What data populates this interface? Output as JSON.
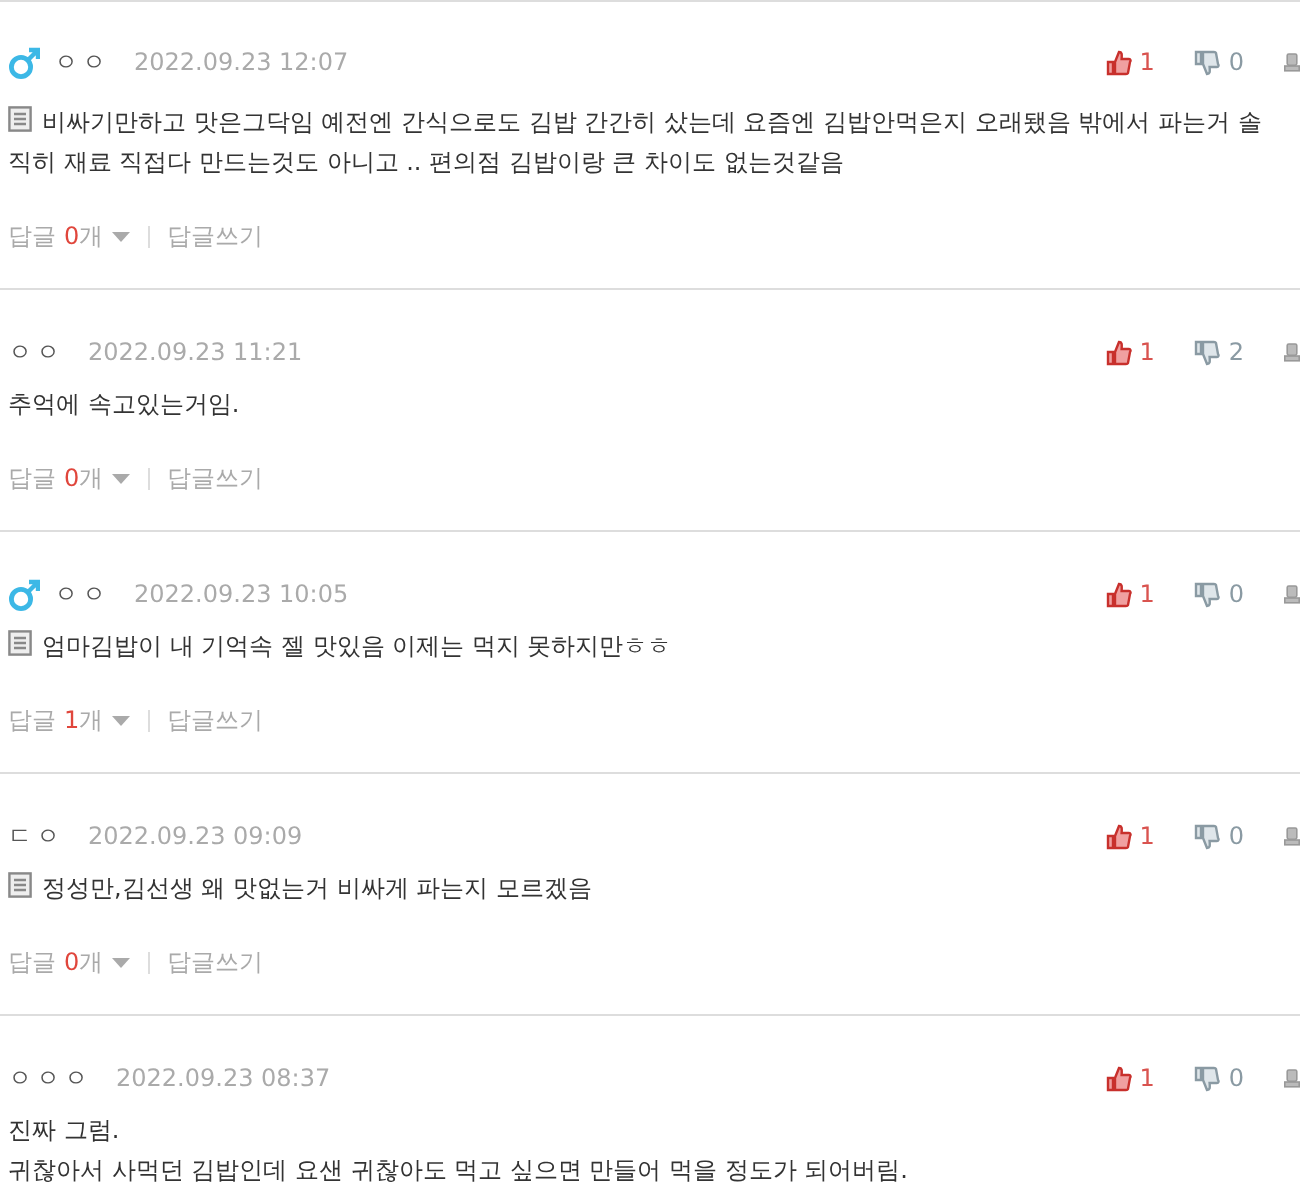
{
  "comments": [
    {
      "male": true,
      "nickname": "ㅇㅇ",
      "date": "2022.09.23 12:07",
      "likes": "1",
      "dislikes": "0",
      "memo": true,
      "body": [
        "비싸기만하고 맛은그닥임 예전엔 간식으로도 김밥 간간히 샀는데 요즘엔 김밥안먹은지 오래됐음 밖에서 파는거 솔직히 재료 직접다 만드는것도 아니고 .. 편의점 김밥이랑 큰 차이도 없는것같음"
      ],
      "reply": {
        "label": "답글",
        "count": "0",
        "unit": "개",
        "write": "답글쓰기"
      }
    },
    {
      "male": false,
      "nickname": "ㅇㅇ",
      "date": "2022.09.23 11:21",
      "likes": "1",
      "dislikes": "2",
      "memo": false,
      "body": [
        "추억에 속고있는거임."
      ],
      "reply": {
        "label": "답글",
        "count": "0",
        "unit": "개",
        "write": "답글쓰기"
      }
    },
    {
      "male": true,
      "nickname": "ㅇㅇ",
      "date": "2022.09.23 10:05",
      "likes": "1",
      "dislikes": "0",
      "memo": true,
      "body": [
        "엄마김밥이 내 기억속 젤 맛있음 이제는 먹지 못하지만ㅎㅎ"
      ],
      "reply": {
        "label": "답글",
        "count": "1",
        "unit": "개",
        "write": "답글쓰기"
      }
    },
    {
      "male": false,
      "nickname": "ㄷㅇ",
      "date": "2022.09.23 09:09",
      "likes": "1",
      "dislikes": "0",
      "memo": true,
      "body": [
        "정성만,김선생 왜 맛없는거 비싸게 파는지 모르겠음"
      ],
      "reply": {
        "label": "답글",
        "count": "0",
        "unit": "개",
        "write": "답글쓰기"
      }
    },
    {
      "male": false,
      "nickname": "ㅇㅇㅇ",
      "date": "2022.09.23 08:37",
      "likes": "1",
      "dislikes": "0",
      "memo": false,
      "body": [
        "진짜 그럼.",
        "귀찮아서 사먹던 김밥인데 요샌 귀찮아도 먹고 싶으면 만들어 먹을 정도가 되어버림."
      ]
    }
  ]
}
